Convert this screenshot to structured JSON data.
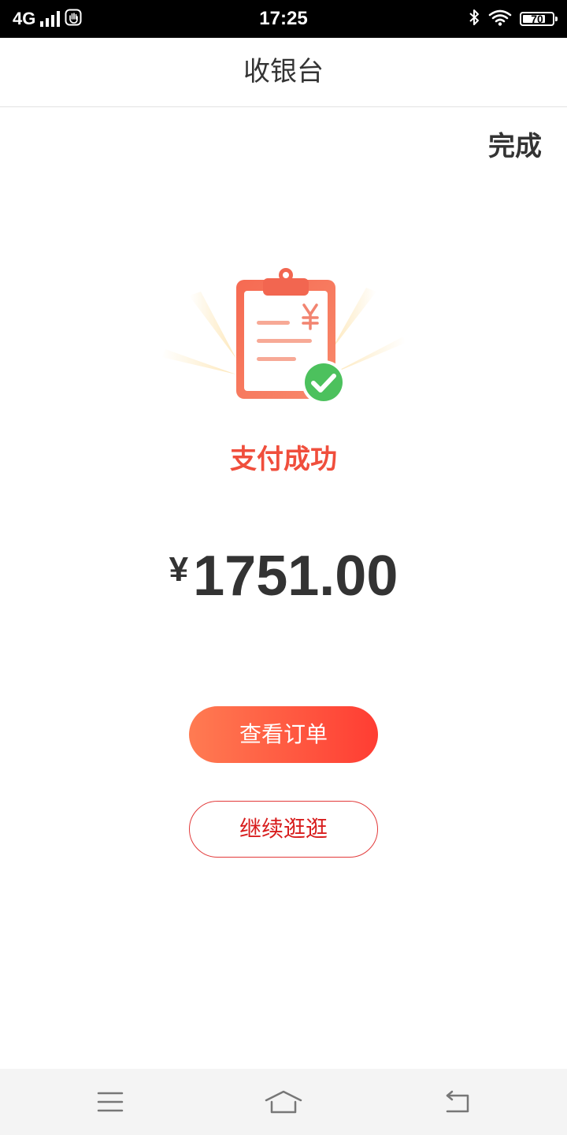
{
  "status_bar": {
    "network": "4G",
    "time": "17:25",
    "battery": "70",
    "icons": [
      "signal-icon",
      "hand-icon",
      "bluetooth-icon",
      "wifi-icon",
      "battery-icon"
    ]
  },
  "header": {
    "title": "收银台"
  },
  "actions": {
    "done_label": "完成"
  },
  "result": {
    "icon": "clipboard-success-icon",
    "message": "支付成功",
    "currency": "¥",
    "amount": "1751.00"
  },
  "buttons": {
    "view_order": "查看订单",
    "continue_shopping": "继续逛逛"
  },
  "nav_bar": {
    "icons": [
      "menu-icon",
      "home-icon",
      "back-icon"
    ]
  },
  "colors": {
    "accent_red": "#f04e3c",
    "gradient_start": "#ff7b52",
    "gradient_end": "#ff3d33",
    "success_green": "#4cc15d",
    "text_dark": "#333333"
  }
}
